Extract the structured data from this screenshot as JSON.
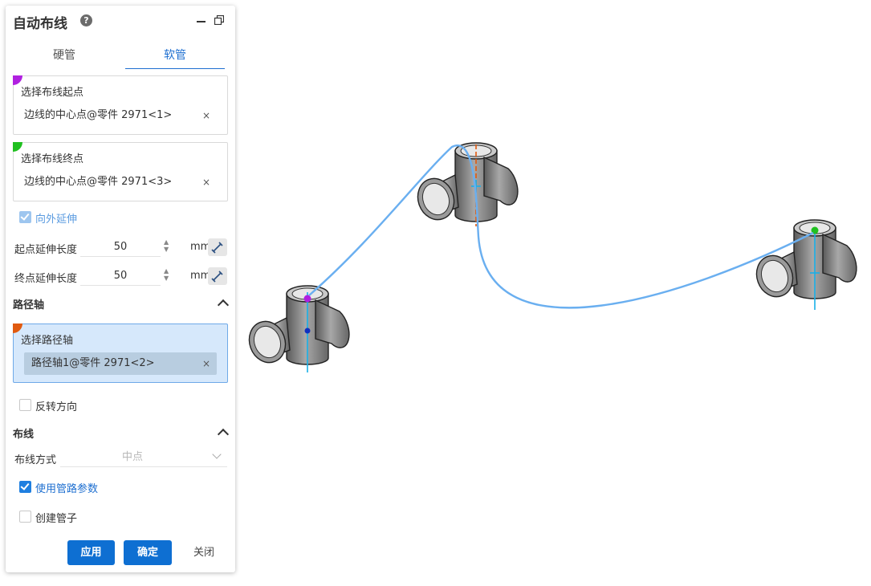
{
  "panel": {
    "title": "自动布线",
    "help_glyph": "?",
    "tabs": [
      {
        "label": "硬管"
      },
      {
        "label": "软管"
      }
    ],
    "active_tab": "软管",
    "start_point": {
      "label": "选择布线起点",
      "value": "边线的中心点@零件 2971<1>",
      "color": "#b020e0"
    },
    "end_point": {
      "label": "选择布线终点",
      "value": "边线的中心点@零件 2971<3>",
      "color": "#20c020"
    },
    "remove_glyph": "×",
    "extend_outward": {
      "label": "向外延伸",
      "checked": true,
      "disabled": true
    },
    "start_extend": {
      "label": "起点延伸长度",
      "value": "50",
      "unit": "mm"
    },
    "end_extend": {
      "label": "终点延伸长度",
      "value": "50",
      "unit": "mm"
    },
    "path_axis_section": {
      "title": "路径轴"
    },
    "path_axis": {
      "label": "选择路径轴",
      "value": "路径轴1@零件 2971<2>",
      "color": "#e05a10"
    },
    "reverse_direction": {
      "label": "反转方向",
      "checked": false
    },
    "routing_section": {
      "title": "布线"
    },
    "routing_mode": {
      "label": "布线方式",
      "value": "中点"
    },
    "use_pipe_params": {
      "label": "使用管路参数",
      "checked": true
    },
    "create_pipe": {
      "label": "创建管子",
      "checked": false
    },
    "buttons": {
      "apply": "应用",
      "ok": "确定",
      "close": "关闭"
    }
  },
  "colors": {
    "accent": "#1e6fd0",
    "route_line": "#6aaff0",
    "pipe_gray": "#8a8a8a",
    "axis_cyan": "#19b0e8"
  }
}
